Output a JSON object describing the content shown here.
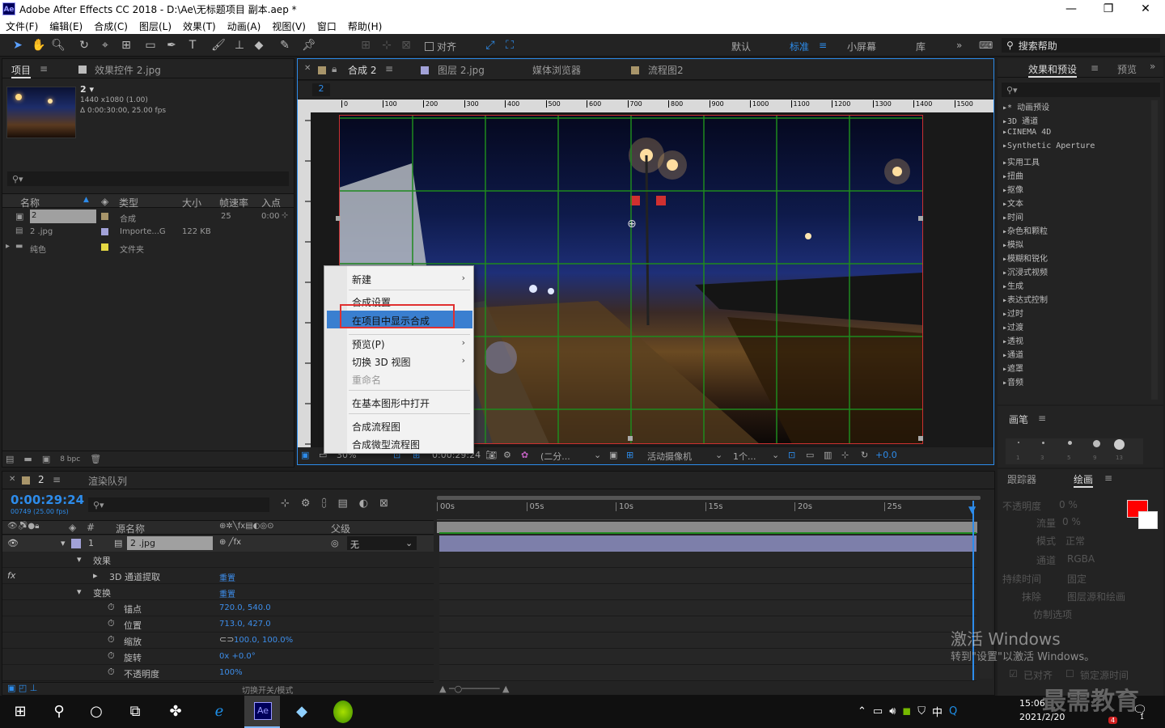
{
  "window": {
    "title": "Adobe After Effects CC 2018 - D:\\Ae\\无标题项目 副本.aep *",
    "app_logo": "Ae"
  },
  "menu": [
    "文件(F)",
    "编辑(E)",
    "合成(C)",
    "图层(L)",
    "效果(T)",
    "动画(A)",
    "视图(V)",
    "窗口",
    "帮助(H)"
  ],
  "toolbar": {
    "snap_label": "对齐",
    "workspaces": [
      "默认",
      "标准",
      "小屏幕",
      "库"
    ],
    "active_workspace": "标准",
    "search_placeholder": "搜索帮助"
  },
  "project": {
    "tab": "项目",
    "effects_tab": "效果控件 2.jpg",
    "comp_name": "2",
    "comp_size": "1440 x1080 (1.00)",
    "comp_duration": "Δ 0:00:30:00, 25.00 fps",
    "columns": [
      "名称",
      "类型",
      "大小",
      "帧速率",
      "入点"
    ],
    "items": [
      {
        "name": "2",
        "type": "合成",
        "size": "",
        "fps": "25",
        "in": "0:00"
      },
      {
        "name": "2 .jpg",
        "type": "Importe...G",
        "size": "122 KB",
        "fps": "",
        "in": ""
      },
      {
        "name": "纯色",
        "type": "文件夹",
        "size": "",
        "fps": "",
        "in": ""
      }
    ],
    "bpc": "8 bpc"
  },
  "viewer": {
    "tabs": [
      "合成 2",
      "图层 2.jpg",
      "媒体浏览器",
      "流程图2"
    ],
    "active_tab": "合成 2",
    "comp_label": "2",
    "ruler": [
      "0",
      "100",
      "200",
      "300",
      "400",
      "500",
      "600",
      "700",
      "800",
      "900",
      "1000",
      "1100",
      "1200",
      "1300",
      "1400",
      "1500"
    ],
    "zoom": "30%",
    "timecode": "0:00:29:24",
    "resolution": "(二分...",
    "camera": "活动摄像机",
    "views": "1个...",
    "exposure": "+0.0"
  },
  "context_menu": {
    "items": [
      {
        "label": "新建",
        "submenu": true
      },
      {
        "label": "合成设置...",
        "submenu": false
      },
      {
        "label": "在项目中显示合成",
        "submenu": false,
        "highlighted": true
      },
      {
        "label": "预览(P)",
        "submenu": true
      },
      {
        "label": "切换 3D 视图",
        "submenu": true
      },
      {
        "label": "重命名",
        "submenu": false,
        "disabled": true
      },
      {
        "label": "在基本图形中打开",
        "submenu": false
      },
      {
        "label": "合成流程图",
        "submenu": false
      },
      {
        "label": "合成微型流程图",
        "submenu": false
      }
    ],
    "highlight_color": "#e03030"
  },
  "effects": {
    "tab": "效果和预设",
    "tab2": "预览",
    "items": [
      "* 动画预设",
      "3D 通道",
      "CINEMA 4D",
      "Synthetic Aperture",
      "实用工具",
      "扭曲",
      "抠像",
      "文本",
      "时间",
      "杂色和颗粒",
      "模拟",
      "模糊和锐化",
      "沉浸式视频",
      "生成",
      "表达式控制",
      "过时",
      "过渡",
      "透视",
      "通道",
      "遮罩",
      "音频"
    ]
  },
  "brush": {
    "tab": "画笔",
    "sizes": [
      "1",
      "3",
      "5",
      "9",
      "13"
    ]
  },
  "paint": {
    "tab1": "跟踪器",
    "tab2": "绘画",
    "opacity_label": "不透明度",
    "opacity": "0 %",
    "flow_label": "流量",
    "flow": "0 %",
    "mode_label": "模式",
    "mode": "正常",
    "channel_label": "通道",
    "channel": "RGBA",
    "duration_label": "持续时间",
    "duration": "固定",
    "erase_label": "抹除",
    "erase": "图层源和绘画",
    "clone_label": "仿制选项",
    "align_label": "已对齐",
    "lock_label": "锁定源时间",
    "fg_color": "#ff0000",
    "bg_color": "#ffffff"
  },
  "timeline": {
    "comp_tab": "2",
    "render_tab": "渲染队列",
    "timecode": "0:00:29:24",
    "frame_info": "00749 (25.00 fps)",
    "col_source": "源名称",
    "col_parent": "父级",
    "layer_num": "1",
    "layer_name": "2 .jpg",
    "parent_value": "无",
    "ruler": [
      "00s",
      "05s",
      "10s",
      "15s",
      "20s",
      "25s"
    ],
    "props": [
      {
        "label": "效果",
        "value": ""
      },
      {
        "label": "3D 通道提取",
        "value": "重置"
      },
      {
        "label": "变换",
        "value": "重置"
      },
      {
        "label": "锚点",
        "value": "720.0, 540.0"
      },
      {
        "label": "位置",
        "value": "713.0, 427.0"
      },
      {
        "label": "缩放",
        "value": "100.0, 100.0%"
      },
      {
        "label": "旋转",
        "value": "0x +0.0°"
      },
      {
        "label": "不透明度",
        "value": "100%"
      }
    ],
    "footer": "切换开关/模式"
  },
  "watermark": {
    "line1": "激活 Windows",
    "line2": "转到\"设置\"以激活 Windows。",
    "logo": "最需教育"
  },
  "taskbar": {
    "time": "15:06",
    "date": "2021/2/20",
    "ime": "中",
    "notify_count": "4",
    "badge": "1"
  }
}
